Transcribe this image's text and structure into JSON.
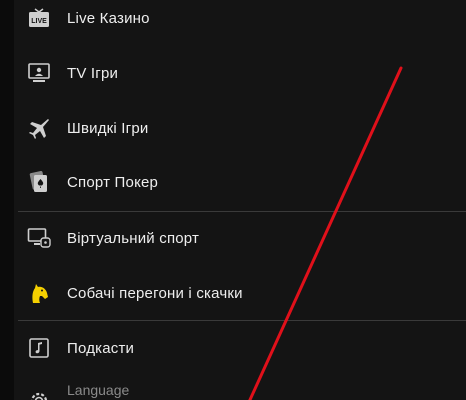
{
  "menu": {
    "items": [
      {
        "label": "Live Казино",
        "icon": "live-tv-icon"
      },
      {
        "label": "TV Ігри",
        "icon": "presenter-screen-icon"
      },
      {
        "label": "Швидкі Ігри",
        "icon": "airplane-icon"
      },
      {
        "label": "Спорт Покер",
        "icon": "playing-cards-icon"
      },
      {
        "label": "Віртуальний спорт",
        "icon": "monitor-gamepad-icon"
      },
      {
        "label": "Собачі перегони і скачки",
        "icon": "horse-head-icon"
      },
      {
        "label": "Подкасти",
        "icon": "music-note-icon"
      },
      {
        "label": "Language",
        "icon": "gear-icon"
      }
    ],
    "live_badge_text": "LIVE"
  },
  "colors": {
    "background": "#141414",
    "text": "#eeeeee",
    "icon": "#cfcfcf",
    "accent_yellow": "#f5d000",
    "divider": "#3a3a3a",
    "annotation_red": "#e0101a"
  }
}
